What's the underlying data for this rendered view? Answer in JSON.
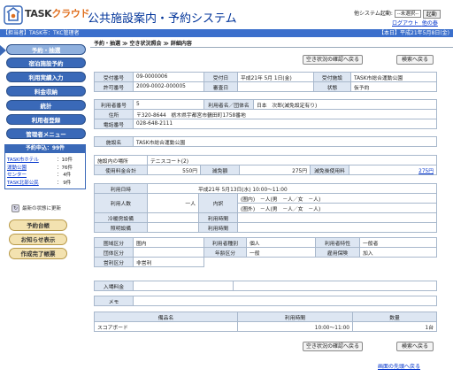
{
  "header": {
    "logo": "TASKクラウド",
    "logo_a": "TASK",
    "logo_b": "クラウド",
    "title": "公共施設案内・予約システム",
    "system_start_label": "他システム起動:",
    "system_select": "--未選択--",
    "start_btn": "起動",
    "logout": "ログアウト",
    "to_top": "他の泰"
  },
  "bar": {
    "left": "【担当者】TASK市：TKC管理者",
    "right": "【本日】平成21年5月8日(金)"
  },
  "breadcrumb": "予約・抽選 ≫ 空き状況照会 ≫ 詳細内容",
  "menu": [
    "予約・抽選",
    "宿泊施設予約",
    "利用実績入力",
    "料金収納",
    "統計",
    "利用者登録",
    "管理者メニュー"
  ],
  "counts": {
    "title": "予約申込：99件",
    "items": [
      {
        "name": "TASK市ホテル",
        "count": "：10件"
      },
      {
        "name": "運動公園",
        "count": "：76件"
      },
      {
        "name": "センター",
        "count": "： 4件"
      },
      {
        "name": "TASK北部公民",
        "count": "： 9件"
      }
    ]
  },
  "refresh": "最新の状態に更新",
  "side_buttons": [
    "予約台帳",
    "お知らせ表示",
    "作成完了帳票"
  ],
  "buttons": {
    "vacancy": "空き状況の確認へ戻る",
    "search": "検索へ戻る"
  },
  "t1": {
    "l1": "受付番号",
    "v1": "09-0000006",
    "l2": "受付日",
    "v2": "平成21年 5月 1日(金)",
    "l3": "受付施設",
    "v3": "TASK市総合運動公園",
    "l4": "許可番号",
    "v4": "2009-0002-000005",
    "l5": "審査日",
    "v5": "",
    "l6": "状態",
    "v6": "仮予約"
  },
  "t2": {
    "l1": "利用者番号",
    "v1": "5",
    "l2": "利用者名／団体名",
    "v2": "日本　次郎(減免設定有り)",
    "l3": "住所",
    "v3": "〒320-8644　栃木県宇都宮市鶴田町1758番地",
    "l4": "電話番号",
    "v4": "028-648-2111"
  },
  "t3": {
    "l": "施設名",
    "v": "TASK市総合運動公園"
  },
  "t4": {
    "l1": "施設内の場所",
    "v1": "テニスコート(2)",
    "l2": "使用料金合計",
    "v2": "550円",
    "l3": "減免額",
    "v3": "275円",
    "l4": "減免後使用料",
    "v4": "275円"
  },
  "t5": {
    "l1": "利用日時",
    "v1": "平成21年 5月13日(水)  10:00～11:00",
    "l2": "利用人数",
    "v2": "一人",
    "l3": "内訳",
    "v3a": "(圏内)　－人(男　－人／女　－人)",
    "v3b": "(圏外)　－人(男　－人／女　－人)",
    "l4": "冷暖房設備",
    "l5": "利用時間",
    "l6": "照明設備",
    "l7": "利用時間"
  },
  "t6": {
    "l1": "圏域区分",
    "v1": "圏内",
    "l2": "利用者種別",
    "v2": "個人",
    "l3": "利用者特性",
    "v3": "一般者",
    "l4": "団体区分",
    "v4": "",
    "l5": "年齢区分",
    "v5": "一般",
    "l6": "雇用保険",
    "v6": "加入",
    "l7": "営利区分",
    "v7": "非営利"
  },
  "t7": {
    "l1": "入場料金",
    "l2": "メモ"
  },
  "t8": {
    "h1": "備品名",
    "h2": "利用時間",
    "h3": "数量",
    "v1": "スコアボード",
    "v2": "10:00～11:00",
    "v3": "1台"
  },
  "to_top": "画面の先頭へ戻る"
}
